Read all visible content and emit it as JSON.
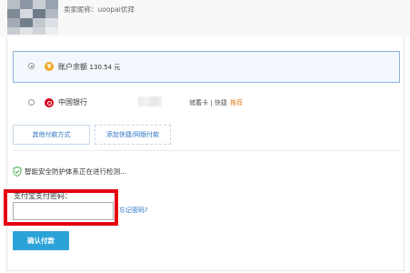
{
  "header": {
    "seller_label": "卖家昵称：",
    "seller_name": "uoopai优拜"
  },
  "payment_options": {
    "balance": {
      "label": "账户余额",
      "amount": "130.54 元",
      "icon": "coin-icon"
    },
    "bank": {
      "name": "中国银行",
      "card_type": "储蓄卡 | 快捷",
      "recommend": "推荐",
      "icon": "bank-icon"
    }
  },
  "buttons": {
    "other_methods": "其他付款方式",
    "add_quick": "添加快捷/网银付款",
    "confirm": "确认付款"
  },
  "security": {
    "status": "智能安全防护体系正在进行检测..."
  },
  "password": {
    "label": "支付宝支付密码：",
    "forgot": "忘记密码?"
  },
  "colors": {
    "accent_blue": "#2ba3d9",
    "link_blue": "#2e75c4",
    "highlight_red": "#e60012",
    "recommend_orange": "#e67e22"
  }
}
